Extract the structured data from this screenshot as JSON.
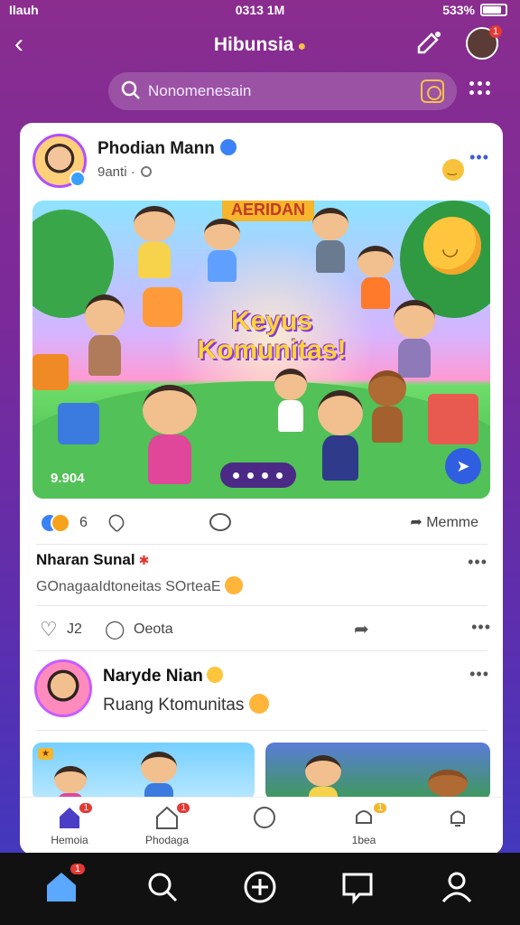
{
  "status": {
    "left": "Ilauh",
    "time": "0313 1M",
    "battery": "533%"
  },
  "header": {
    "title": "Hibunsia",
    "back_glyph": "‹"
  },
  "search": {
    "placeholder": "Nonomenesain"
  },
  "post1": {
    "author": "Phodian Mann",
    "meta": "9anti ·",
    "hero": {
      "banner": "AERIDAN",
      "title": "Keyus Komunitas!",
      "count": "9.904"
    },
    "reactions_count": "6",
    "share_label": "Memme"
  },
  "comment1": {
    "name": "Nharan Sunal",
    "text": "GOnagaaIdtoneitas SOrteaE"
  },
  "actions2": {
    "like_count": "J2",
    "chat_label": "Oeota"
  },
  "post2": {
    "author": "Naryde Nian",
    "subtitle": "Ruang Ktomunitas"
  },
  "inner_nav": [
    {
      "label": "Hemoia",
      "icon": "home-icon",
      "badge": "1"
    },
    {
      "label": "Phodaga",
      "icon": "house-outline-icon",
      "badge": "1"
    },
    {
      "label": "",
      "icon": "chat-icon",
      "badge": ""
    },
    {
      "label": "1bea",
      "icon": "notification-icon",
      "badge": "1"
    },
    {
      "label": "",
      "icon": "bell-icon",
      "badge": ""
    }
  ],
  "bottom_bar": {
    "home_badge": "1"
  },
  "colors": {
    "accent": "#3b82f6",
    "brand_gradient_top": "#8a2d8f",
    "brand_gradient_bottom": "#3b3bc2",
    "badge": "#e53935"
  }
}
